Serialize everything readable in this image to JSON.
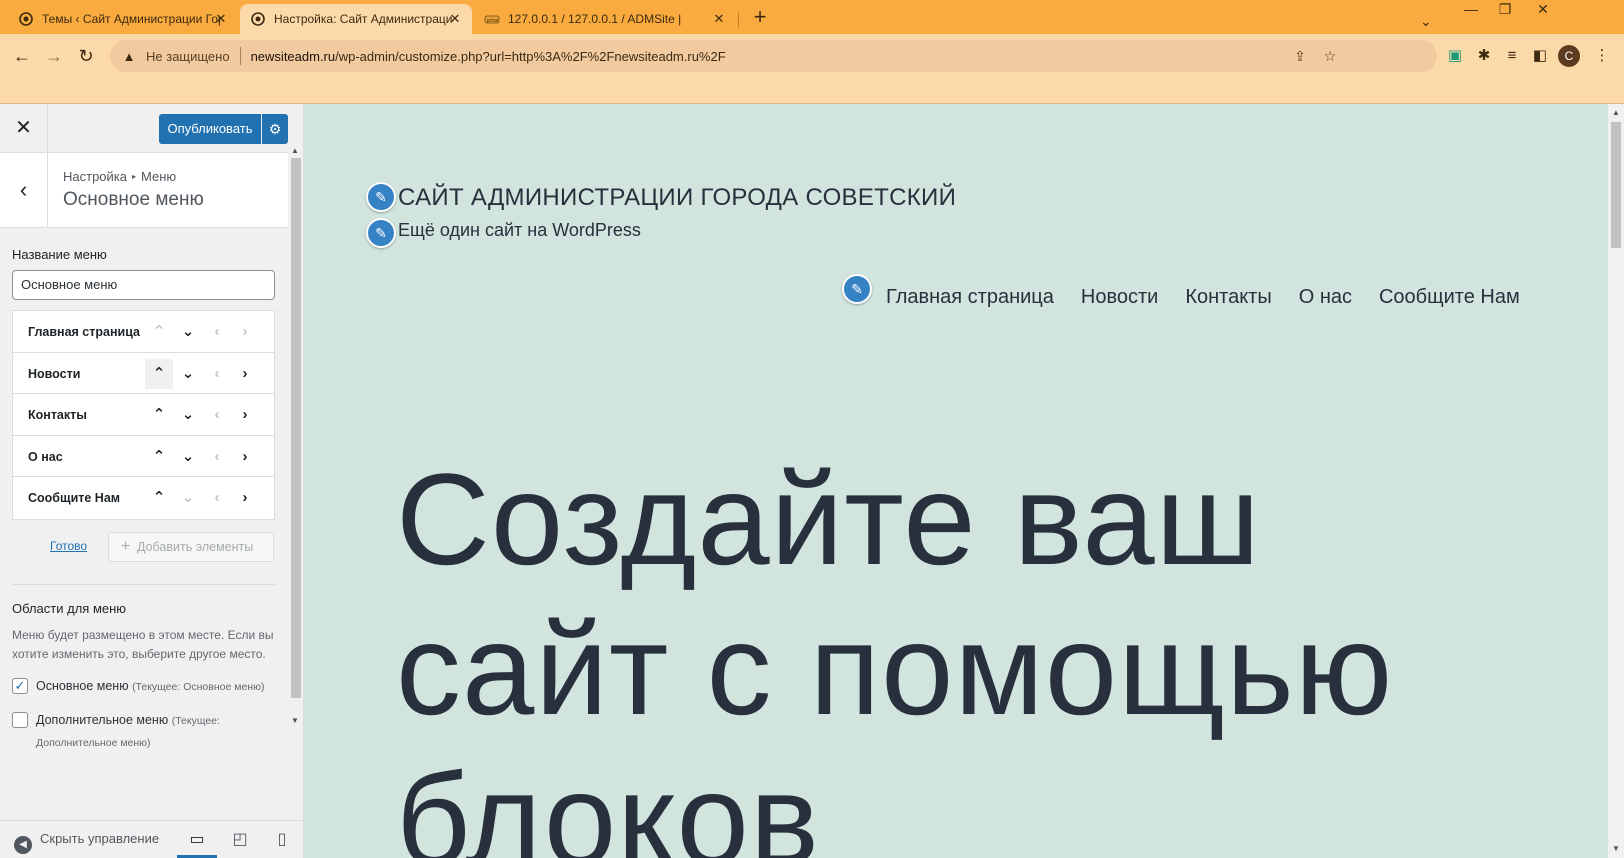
{
  "browser": {
    "tabs": [
      {
        "title": "Темы ‹ Сайт Администрации Гор",
        "active": false
      },
      {
        "title": "Настройка: Сайт Администрации",
        "active": true
      },
      {
        "title": "127.0.0.1 / 127.0.0.1 / ADMSite |",
        "active": false
      }
    ],
    "insecure_label": "Не защищено",
    "url_domain": "newsiteadm.ru",
    "url_path": "/wp-admin/customize.php?url=http%3A%2F%2Fnewsiteadm.ru%2F",
    "avatar_letter": "C"
  },
  "customizer": {
    "publish_label": "Опубликовать",
    "breadcrumb_root": "Настройка",
    "breadcrumb_section": "Меню",
    "section_title": "Основное меню",
    "menu_name_label": "Название меню",
    "menu_name_value": "Основное меню",
    "menu_items": [
      {
        "label": "Главная страница"
      },
      {
        "label": "Новости"
      },
      {
        "label": "Контакты"
      },
      {
        "label": "О нас"
      },
      {
        "label": "Сообщите Нам"
      }
    ],
    "done_label": "Готово",
    "add_items_label": "Добавить элементы",
    "locations_title": "Области для меню",
    "locations_desc": "Меню будет размещено в этом месте. Если вы хотите изменить это, выберите другое место.",
    "locations": [
      {
        "name": "Основное меню",
        "current": "(Текущее: Основное меню)",
        "checked": true
      },
      {
        "name": "Дополнительное меню",
        "current": "(Текущее: Дополнительное меню)",
        "checked": false
      }
    ],
    "collapse_label": "Скрыть управление"
  },
  "preview": {
    "site_title": "САЙТ АДМИНИСТРАЦИИ ГОРОДА СОВЕТСКИЙ",
    "site_tagline": "Ещё один сайт на WordPress",
    "nav": [
      "Главная страница",
      "Новости",
      "Контакты",
      "О нас",
      "Сообщите Нам"
    ],
    "hero_line1": "Создайте ваш",
    "hero_line2": "сайт с помощью",
    "hero_line3": "блоков"
  },
  "colors": {
    "tabbar": "#f9ab3f",
    "toolbar": "#fcd9a8",
    "wp_blue": "#2271b1",
    "preview_bg": "#d1e4dd"
  }
}
